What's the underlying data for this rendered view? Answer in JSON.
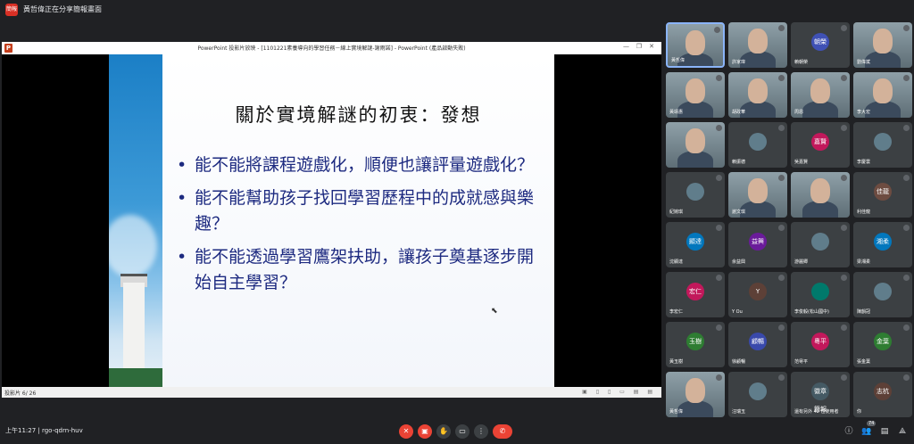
{
  "header": {
    "presenter_chip": "簡報",
    "presenter_text": "黃哲偉正在分享簡報畫面"
  },
  "window": {
    "title": "PowerPoint 投影片放映 - [1101221素養導向的學習任務－線上實境解謎-謝雨諾] - PowerPoint (產品啟動失敗)",
    "logo": "P",
    "controls": [
      "—",
      "❐",
      "✕"
    ]
  },
  "slide": {
    "heading": "關於實境解謎的初衷：發想",
    "bullets": [
      "能不能將課程遊戲化，順便也讓評量遊戲化？",
      "能不能幫助孩子找回學習歷程中的成就感與樂趣？",
      "能不能透過學習鷹架扶助，讓孩子奠基逐步開始自主學習？"
    ]
  },
  "status": {
    "slide_counter": "投影片 6/ 26",
    "tools": "▣ ▯ ▯ ▭ ▤ ▤"
  },
  "participants": [
    {
      "name": "黃哲偉",
      "initials": "",
      "color": "#5f6368",
      "video": true,
      "active": true
    },
    {
      "name": "許家瑋",
      "initials": "",
      "color": "#5f6368",
      "video": true,
      "active": false
    },
    {
      "name": "賴朝榮",
      "initials": "朝榮",
      "color": "#3f51b5",
      "video": false,
      "active": false
    },
    {
      "name": "劉偉斌",
      "initials": "",
      "color": "#5f6368",
      "video": true,
      "active": false
    },
    {
      "name": "黃靖惠",
      "initials": "",
      "color": "#5f6368",
      "video": true,
      "active": false
    },
    {
      "name": "胡政華",
      "initials": "",
      "color": "#5f6368",
      "video": true,
      "active": false
    },
    {
      "name": "周恩",
      "initials": "",
      "color": "#5f6368",
      "video": true,
      "active": false
    },
    {
      "name": "李大宏",
      "initials": "",
      "color": "#5f6368",
      "video": true,
      "active": false
    },
    {
      "name": "",
      "initials": "",
      "color": "#5f6368",
      "video": true,
      "active": false
    },
    {
      "name": "賴振德",
      "initials": "",
      "color": "#607d8b",
      "video": false,
      "active": false
    },
    {
      "name": "吳嘉賢",
      "initials": "嘉賢",
      "color": "#c2185b",
      "video": false,
      "active": false
    },
    {
      "name": "李慶雲",
      "initials": "",
      "color": "#607d8b",
      "video": false,
      "active": false
    },
    {
      "name": "紀婉琪",
      "initials": "",
      "color": "#607d8b",
      "video": false,
      "active": false
    },
    {
      "name": "謝文琪",
      "initials": "",
      "color": "#5f6368",
      "video": true,
      "active": false
    },
    {
      "name": "",
      "initials": "",
      "color": "#5f6368",
      "video": true,
      "active": false
    },
    {
      "name": "利佳龍",
      "initials": "佳龍",
      "color": "#6d4c41",
      "video": false,
      "active": false
    },
    {
      "name": "沈顯達",
      "initials": "顯達",
      "color": "#0277bd",
      "video": false,
      "active": false
    },
    {
      "name": "余益興",
      "initials": "益興",
      "color": "#6a1b9a",
      "video": false,
      "active": false
    },
    {
      "name": "游麗卿",
      "initials": "",
      "color": "#607d8b",
      "video": false,
      "active": false
    },
    {
      "name": "梁湘柔",
      "initials": "湘柔",
      "color": "#0277bd",
      "video": false,
      "active": false
    },
    {
      "name": "李宏仁",
      "initials": "宏仁",
      "color": "#c2185b",
      "video": false,
      "active": false
    },
    {
      "name": "Y Ou",
      "initials": "Y",
      "color": "#5d4037",
      "video": false,
      "active": false
    },
    {
      "name": "李俊毅(松山國中)",
      "initials": "",
      "color": "#00796b",
      "video": false,
      "active": false
    },
    {
      "name": "陳韻冠",
      "initials": "",
      "color": "#607d8b",
      "video": false,
      "active": false
    },
    {
      "name": "黃玉樹",
      "initials": "玉樹",
      "color": "#2e7d32",
      "video": false,
      "active": false
    },
    {
      "name": "徐顧暢",
      "initials": "顧暢",
      "color": "#3949ab",
      "video": false,
      "active": false
    },
    {
      "name": "范粵平",
      "initials": "粵平",
      "color": "#c2185b",
      "video": false,
      "active": false
    },
    {
      "name": "張金葉",
      "initials": "金葉",
      "color": "#2e7d32",
      "video": false,
      "active": false
    },
    {
      "name": "黃哲偉",
      "initials": "",
      "color": "#5f6368",
      "video": true,
      "active": false
    },
    {
      "name": "汪瑞玉",
      "initials": "",
      "color": "#607d8b",
      "video": false,
      "active": false
    },
    {
      "name": "還有另外 42 位使用者",
      "initials": "徽章 簡報",
      "color": "#455a64",
      "video": false,
      "active": false
    },
    {
      "name": "你",
      "initials": "志杭",
      "color": "#5d4037",
      "video": false,
      "active": false
    }
  ],
  "bottom": {
    "time": "上午11:27",
    "meeting_code": "rgo-qdrn-huv",
    "time_and_code": "上午11:27  |  rgo-qdrn-huv",
    "participant_count": "74",
    "buttons": [
      "mic-off",
      "camera-off",
      "raise-hand",
      "present",
      "more"
    ],
    "leave_label": "✆"
  }
}
